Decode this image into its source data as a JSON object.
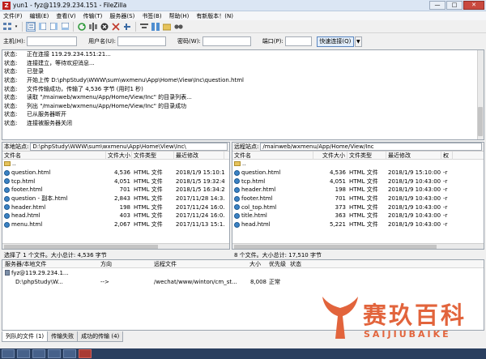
{
  "window": {
    "app_icon": "Z",
    "title": "yun1 - fyz@119.29.234.151 - FileZilla",
    "min": "—",
    "max": "□",
    "close": "✕"
  },
  "menu": [
    "文件(F)",
    "编辑(E)",
    "查看(V)",
    "传输(T)",
    "服务器(S)",
    "书签(B)",
    "帮助(H)",
    "有新版本！(N)"
  ],
  "quickconnect": {
    "host_label": "主机(H):",
    "user_label": "用户名(U):",
    "pass_label": "密码(W):",
    "port_label": "端口(P):",
    "button": "快速连接(Q)",
    "dropdown": "▼"
  },
  "log": [
    {
      "label": "状态:",
      "msg": "正在连接 119.29.234.151:21..."
    },
    {
      "label": "状态:",
      "msg": "连接建立，等待欢迎消息..."
    },
    {
      "label": "状态:",
      "msg": "已登录"
    },
    {
      "label": "状态:",
      "msg": "开始上传 D:\\phpStudy\\WWW\\sum\\wxmenu\\App\\Home\\View\\Inc\\question.html"
    },
    {
      "label": "状态:",
      "msg": "文件传输成功，传输了 4,536 字节 (用时1 秒)"
    },
    {
      "label": "状态:",
      "msg": "读取 \"/mainweb/wxmenu/App/Home/View/Inc\" 的目录列表..."
    },
    {
      "label": "状态:",
      "msg": "列出 \"/mainweb/wxmenu/App/Home/View/Inc\" 的目录成功"
    },
    {
      "label": "状态:",
      "msg": "已从服务器断开"
    },
    {
      "label": "状态:",
      "msg": "连接被服务器关闭"
    }
  ],
  "local": {
    "path_label": "本地站点:",
    "path": "D:\\phpStudy\\WWW\\sum\\wxmenu\\App\\Home\\View\\Inc\\",
    "headers": [
      "文件名",
      "文件大小",
      "文件类型",
      "最近修改"
    ],
    "files": [
      {
        "name": "..",
        "size": "",
        "type": "",
        "modified": "",
        "dir": true
      },
      {
        "name": "question.html",
        "size": "4,536",
        "type": "HTML 文件",
        "modified": "2018/1/9 15:10:10"
      },
      {
        "name": "tcp.html",
        "size": "4,051",
        "type": "HTML 文件",
        "modified": "2018/1/5 19:32:48"
      },
      {
        "name": "footer.html",
        "size": "701",
        "type": "HTML 文件",
        "modified": "2018/1/5 16:34:20"
      },
      {
        "name": "question - 副本.html",
        "size": "2,843",
        "type": "HTML 文件",
        "modified": "2017/11/28 14:3..."
      },
      {
        "name": "header.html",
        "size": "198",
        "type": "HTML 文件",
        "modified": "2017/11/24 16:0..."
      },
      {
        "name": "head.html",
        "size": "403",
        "type": "HTML 文件",
        "modified": "2017/11/24 16:0..."
      },
      {
        "name": "menu.html",
        "size": "2,067",
        "type": "HTML 文件",
        "modified": "2017/11/13 15:1..."
      }
    ],
    "status": "选择了 1 个文件。大小总计: 4,536 字节"
  },
  "remote": {
    "path_label": "远程站点:",
    "path": "/mainweb/wxmenu/App/Home/View/Inc",
    "headers": [
      "文件名",
      "文件大小",
      "文件类型",
      "最近修改",
      "权"
    ],
    "files": [
      {
        "name": "..",
        "size": "",
        "type": "",
        "modified": "",
        "perm": "",
        "dir": true
      },
      {
        "name": "question.html",
        "size": "4,536",
        "type": "HTML 文件",
        "modified": "2018/1/9 15:10:00",
        "perm": "-r"
      },
      {
        "name": "tcp.html",
        "size": "4,051",
        "type": "HTML 文件",
        "modified": "2018/1/9 10:43:00",
        "perm": "-r"
      },
      {
        "name": "header.html",
        "size": "198",
        "type": "HTML 文件",
        "modified": "2018/1/9 10:43:00",
        "perm": "-r"
      },
      {
        "name": "footer.html",
        "size": "701",
        "type": "HTML 文件",
        "modified": "2018/1/9 10:43:00",
        "perm": "-r"
      },
      {
        "name": "col_top.html",
        "size": "373",
        "type": "HTML 文件",
        "modified": "2018/1/9 10:43:00",
        "perm": "-r"
      },
      {
        "name": "title.html",
        "size": "363",
        "type": "HTML 文件",
        "modified": "2018/1/9 10:43:00",
        "perm": "-r"
      },
      {
        "name": "head.html",
        "size": "5,221",
        "type": "HTML 文件",
        "modified": "2018/1/9 10:43:00",
        "perm": "-r"
      }
    ],
    "status": "8 个文件。大小总计: 17,510 字节"
  },
  "queue": {
    "headers": [
      "服务器/本地文件",
      "方向",
      "远程文件",
      "大小",
      "优先级",
      "状态"
    ],
    "server": "fyz@119.29.234.1...",
    "item": {
      "local": "D:\\phpStudy\\W...",
      "direction": "-->",
      "remote": "/wechat/www/winton/cm_st...",
      "size": "8,008",
      "priority": "正常",
      "status": ""
    },
    "tabs": [
      "列队的文件 (1)",
      "传输失败",
      "成功的传输 (4)"
    ]
  },
  "watermark": {
    "cn": "赛玖百科",
    "en": "SAIJIUBAIKE"
  },
  "colors": {
    "watermark": "#e2643c",
    "title_bar": "#dbe6f4",
    "taskbar": "#2a3f5f",
    "file_icon": "#3b82c4"
  }
}
